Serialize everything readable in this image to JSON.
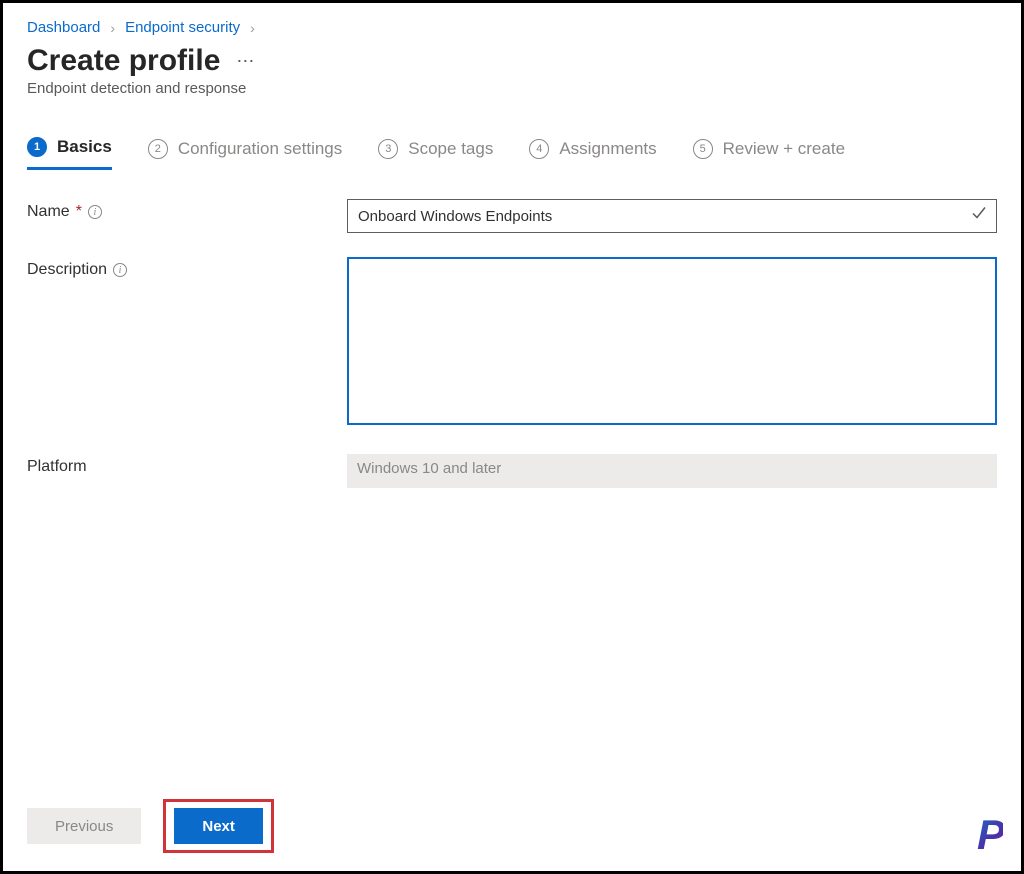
{
  "breadcrumb": {
    "items": [
      "Dashboard",
      "Endpoint security"
    ]
  },
  "header": {
    "title": "Create profile",
    "subtitle": "Endpoint detection and response"
  },
  "steps": [
    {
      "num": "1",
      "label": "Basics",
      "active": true
    },
    {
      "num": "2",
      "label": "Configuration settings",
      "active": false
    },
    {
      "num": "3",
      "label": "Scope tags",
      "active": false
    },
    {
      "num": "4",
      "label": "Assignments",
      "active": false
    },
    {
      "num": "5",
      "label": "Review + create",
      "active": false
    }
  ],
  "form": {
    "name_label": "Name",
    "name_value": "Onboard Windows Endpoints",
    "description_label": "Description",
    "description_value": "",
    "platform_label": "Platform",
    "platform_value": "Windows 10 and later"
  },
  "footer": {
    "previous_label": "Previous",
    "next_label": "Next"
  },
  "logo_text": "P"
}
